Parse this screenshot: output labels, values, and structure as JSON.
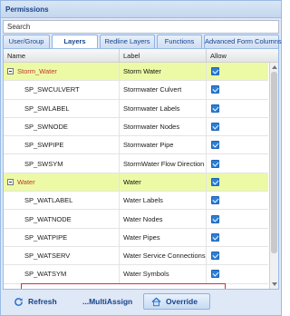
{
  "title": "Permissions",
  "search": {
    "placeholder": "Search"
  },
  "tabs": [
    {
      "label": "User/Group",
      "active": false
    },
    {
      "label": "Layers",
      "active": true
    },
    {
      "label": "Redline Layers",
      "active": false
    },
    {
      "label": "Functions",
      "active": false
    },
    {
      "label": "Advanced Form Columns",
      "active": false
    }
  ],
  "grid": {
    "columns": {
      "name": "Name",
      "label": "Label",
      "allow": "Allow"
    },
    "rows": [
      {
        "type": "group",
        "name": "Storm_Water",
        "label": "Storm Water",
        "allow": true
      },
      {
        "type": "child",
        "name": "SP_SWCULVERT",
        "label": "Stormwater Culvert",
        "allow": true
      },
      {
        "type": "child",
        "name": "SP_SWLABEL",
        "label": "Stormwater Labels",
        "allow": true
      },
      {
        "type": "child",
        "name": "SP_SWNODE",
        "label": "Stormwater Nodes",
        "allow": true
      },
      {
        "type": "child",
        "name": "SP_SWPIPE",
        "label": "Stormwater Pipe",
        "allow": true
      },
      {
        "type": "child",
        "name": "SP_SWSYM",
        "label": "StormWater Flow Direction",
        "allow": true
      },
      {
        "type": "group",
        "name": "Water",
        "label": "Water",
        "allow": true
      },
      {
        "type": "child",
        "name": "SP_WATLABEL",
        "label": "Water Labels",
        "allow": true
      },
      {
        "type": "child",
        "name": "SP_WATNODE",
        "label": "Water Nodes",
        "allow": true
      },
      {
        "type": "child",
        "name": "SP_WATPIPE",
        "label": "Water Pipes",
        "allow": true,
        "highlighted": true
      },
      {
        "type": "child",
        "name": "SP_WATSERV",
        "label": "Water Service Connections",
        "allow": true
      },
      {
        "type": "child",
        "name": "SP_WATSYM",
        "label": "Water Symbols",
        "allow": true
      }
    ]
  },
  "toolbar": {
    "refresh_label": "Refresh",
    "multiassign_label": "...MultiAssign",
    "override_label": "Override"
  },
  "colors": {
    "group_row": "#ecfaa6",
    "group_name": "#c0392b",
    "checkbox": "#2e7fd6",
    "highlight_border": "#d0303a",
    "header_text": "#15428b"
  }
}
